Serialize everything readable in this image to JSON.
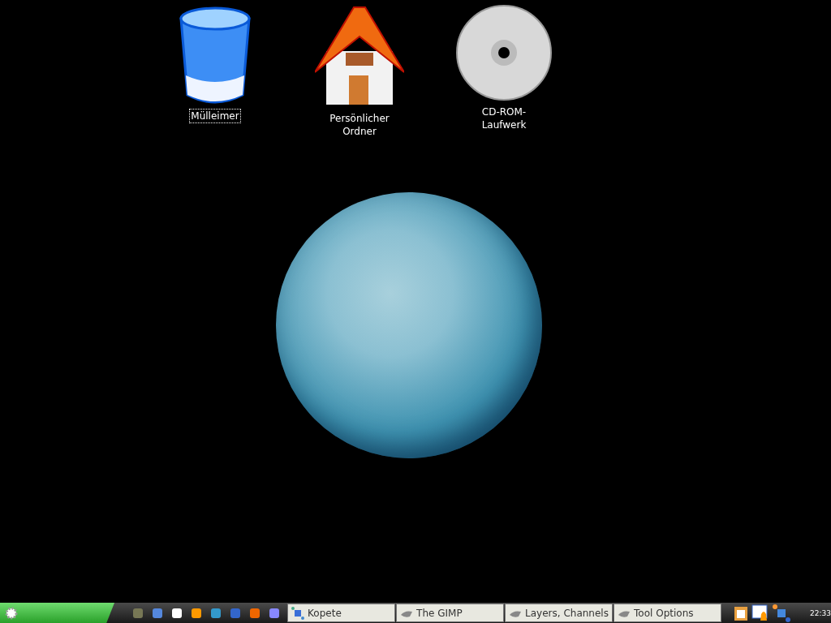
{
  "desktop_icons": [
    {
      "kind": "trash",
      "label": "Mülleimer",
      "selected": true
    },
    {
      "kind": "home",
      "label": "Persönlicher Ordner",
      "selected": false
    },
    {
      "kind": "cdrom",
      "label": "CD-ROM-Laufwerk",
      "selected": false
    }
  ],
  "taskbar": {
    "tasks": [
      {
        "kind": "kopete",
        "label": "Kopete"
      },
      {
        "kind": "gimp",
        "label": "The GIMP"
      },
      {
        "kind": "gimp",
        "label": "Layers, Channels"
      },
      {
        "kind": "gimp",
        "label": "Tool Options"
      }
    ],
    "clock": "22:33"
  }
}
